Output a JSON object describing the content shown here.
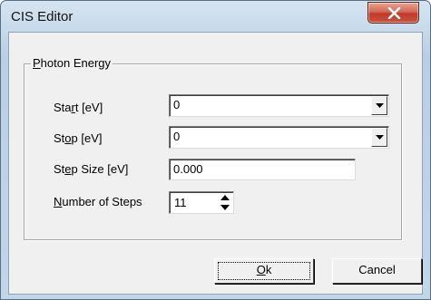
{
  "window": {
    "title": "CIS Editor",
    "close_icon": "close-x-icon"
  },
  "group": {
    "label_prefix": "",
    "label_mnemonic": "P",
    "label_rest": "hoton Energy"
  },
  "fields": {
    "start": {
      "pre": "Sta",
      "mn": "r",
      "post": "t [eV]",
      "value": "0"
    },
    "stop": {
      "pre": "St",
      "mn": "o",
      "post": "p [eV]",
      "value": "0"
    },
    "step_size": {
      "pre": "St",
      "mn": "e",
      "post": "p Size [eV]",
      "value": "0.000"
    },
    "num_steps": {
      "pre": "",
      "mn": "N",
      "post": "umber of Steps",
      "value": "11"
    }
  },
  "buttons": {
    "ok_mn": "O",
    "ok_rest": "k",
    "cancel": "Cancel"
  }
}
